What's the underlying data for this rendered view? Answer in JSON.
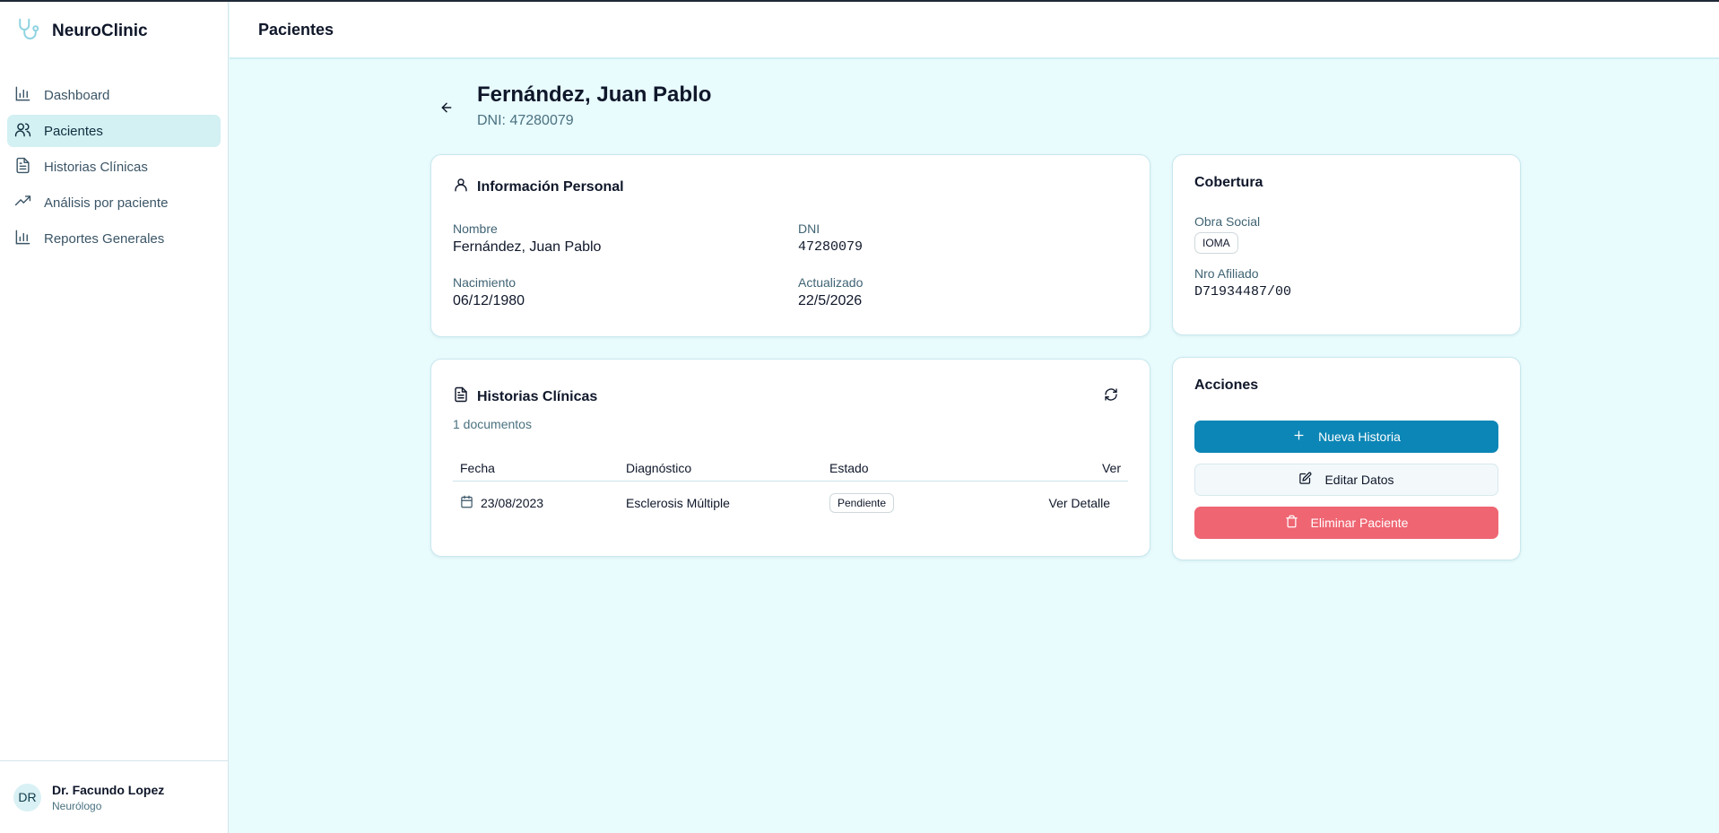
{
  "app": {
    "name": "NeuroClinic"
  },
  "sidebar": {
    "items": [
      {
        "label": "Dashboard",
        "icon": "bar-chart-icon",
        "active": false
      },
      {
        "label": "Pacientes",
        "icon": "users-icon",
        "active": true
      },
      {
        "label": "Historias Clínicas",
        "icon": "file-text-icon",
        "active": false
      },
      {
        "label": "Análisis por paciente",
        "icon": "trending-up-icon",
        "active": false
      },
      {
        "label": "Reportes Generales",
        "icon": "bar-chart-icon",
        "active": false
      }
    ],
    "user": {
      "initials": "DR",
      "name": "Dr. Facundo Lopez",
      "role": "Neurólogo"
    }
  },
  "header": {
    "title": "Pacientes"
  },
  "patient": {
    "name": "Fernández, Juan Pablo",
    "dni_line": "DNI: 47280079"
  },
  "personal_info": {
    "title": "Información Personal",
    "fields": {
      "nombre_label": "Nombre",
      "nombre": "Fernández, Juan Pablo",
      "dni_label": "DNI",
      "dni": "47280079",
      "nacimiento_label": "Nacimiento",
      "nacimiento": "06/12/1980",
      "actualizado_label": "Actualizado",
      "actualizado": "22/5/2026"
    }
  },
  "historias": {
    "title": "Historias Clínicas",
    "count_text": "1 documentos",
    "columns": [
      "Fecha",
      "Diagnóstico",
      "Estado",
      "Ver"
    ],
    "rows": [
      {
        "fecha": "23/08/2023",
        "diagnostico": "Esclerosis Múltiple",
        "estado": "Pendiente",
        "ver": "Ver Detalle"
      }
    ]
  },
  "cobertura": {
    "title": "Cobertura",
    "obra_social_label": "Obra Social",
    "obra_social": "IOMA",
    "afiliado_label": "Nro Afiliado",
    "afiliado": "D71934487/00"
  },
  "acciones": {
    "title": "Acciones",
    "nueva": "Nueva Historia",
    "editar": "Editar Datos",
    "eliminar": "Eliminar Paciente"
  },
  "colors": {
    "accent": "#0c86b6",
    "danger": "#ef6572",
    "background": "#e8fbfd",
    "active_nav": "#d3f0f3"
  }
}
